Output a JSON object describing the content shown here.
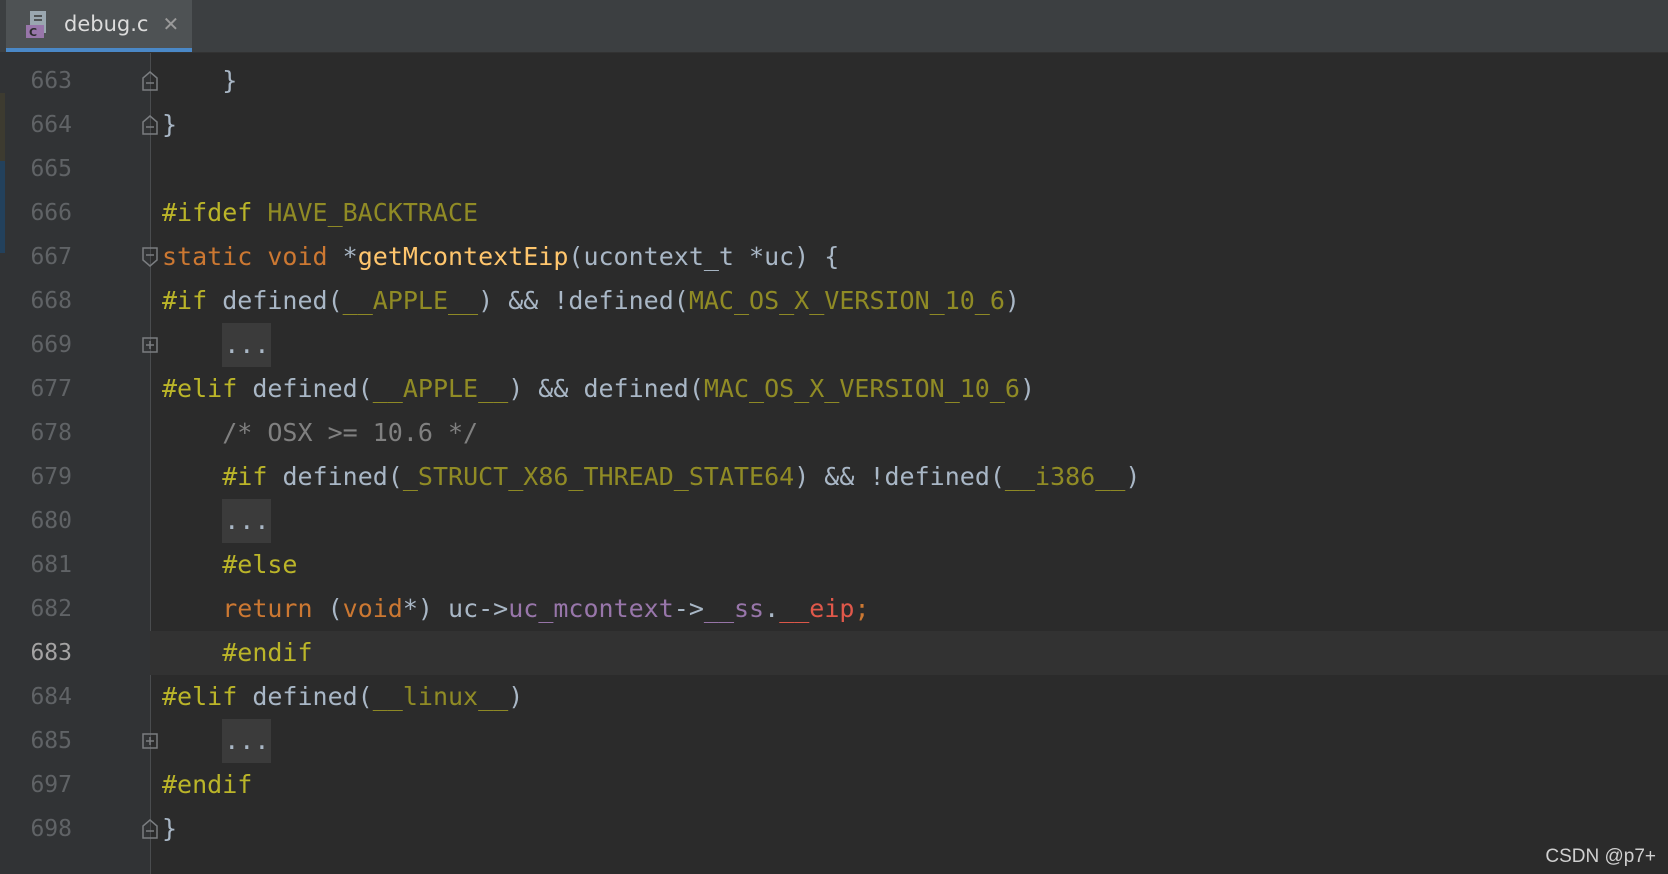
{
  "tab": {
    "filename": "debug.c",
    "icon_letter": "C",
    "close_glyph": "✕"
  },
  "colors": {
    "preprocessor": "#bbb529",
    "macro": "#908b25",
    "keyword": "#cc7832",
    "function": "#ffc66d",
    "field": "#9876aa",
    "comment": "#808080",
    "text": "#a9b7c6",
    "tab_accent": "#4a88c7"
  },
  "lines": [
    {
      "num": "663",
      "fold": "end",
      "tokens": [
        {
          "t": "    }",
          "c": "plain"
        }
      ]
    },
    {
      "num": "664",
      "fold": "end",
      "tokens": [
        {
          "t": "}",
          "c": "plain"
        }
      ]
    },
    {
      "num": "665",
      "fold": "",
      "tokens": []
    },
    {
      "num": "666",
      "fold": "",
      "tokens": [
        {
          "t": "#ifdef ",
          "c": "pre"
        },
        {
          "t": "HAVE_BACKTRACE",
          "c": "macro"
        }
      ]
    },
    {
      "num": "667",
      "fold": "start",
      "tokens": [
        {
          "t": "static ",
          "c": "kw"
        },
        {
          "t": "void ",
          "c": "kw"
        },
        {
          "t": "*",
          "c": "plain"
        },
        {
          "t": "getMcontextEip",
          "c": "fn"
        },
        {
          "t": "(ucontext_t *uc) {",
          "c": "plain"
        }
      ]
    },
    {
      "num": "668",
      "fold": "",
      "tokens": [
        {
          "t": "#if ",
          "c": "pre"
        },
        {
          "t": "defined(",
          "c": "plain"
        },
        {
          "t": "__APPLE__",
          "c": "macro"
        },
        {
          "t": ") && !defined(",
          "c": "plain"
        },
        {
          "t": "MAC_OS_X_VERSION_10_6",
          "c": "macro"
        },
        {
          "t": ")",
          "c": "plain"
        }
      ]
    },
    {
      "num": "669",
      "fold": "collapsed",
      "tokens": [
        {
          "t": "    ",
          "c": "plain"
        },
        {
          "t": "...",
          "c": "folded"
        }
      ]
    },
    {
      "num": "677",
      "fold": "",
      "tokens": [
        {
          "t": "#elif ",
          "c": "pre"
        },
        {
          "t": "defined(",
          "c": "plain"
        },
        {
          "t": "__APPLE__",
          "c": "macro"
        },
        {
          "t": ") && defined(",
          "c": "plain"
        },
        {
          "t": "MAC_OS_X_VERSION_10_6",
          "c": "macro"
        },
        {
          "t": ")",
          "c": "plain"
        }
      ]
    },
    {
      "num": "678",
      "fold": "",
      "tokens": [
        {
          "t": "    /* OSX >= 10.6 */",
          "c": "cmt"
        }
      ]
    },
    {
      "num": "679",
      "fold": "",
      "tokens": [
        {
          "t": "    ",
          "c": "plain"
        },
        {
          "t": "#if ",
          "c": "pre"
        },
        {
          "t": "defined(",
          "c": "plain"
        },
        {
          "t": "_STRUCT_X86_THREAD_STATE64",
          "c": "macro"
        },
        {
          "t": ") && !defined(",
          "c": "plain"
        },
        {
          "t": "__i386__",
          "c": "macro"
        },
        {
          "t": ")",
          "c": "plain"
        }
      ]
    },
    {
      "num": "680",
      "fold": "",
      "tokens": [
        {
          "t": "    ",
          "c": "plain"
        },
        {
          "t": "...",
          "c": "folded"
        }
      ]
    },
    {
      "num": "681",
      "fold": "",
      "tokens": [
        {
          "t": "    ",
          "c": "plain"
        },
        {
          "t": "#else",
          "c": "pre"
        }
      ]
    },
    {
      "num": "682",
      "fold": "",
      "tokens": [
        {
          "t": "    ",
          "c": "plain"
        },
        {
          "t": "return ",
          "c": "kw"
        },
        {
          "t": "(",
          "c": "plain"
        },
        {
          "t": "void",
          "c": "kw"
        },
        {
          "t": "*) uc->",
          "c": "plain"
        },
        {
          "t": "uc_mcontext",
          "c": "field"
        },
        {
          "t": "->",
          "c": "plain"
        },
        {
          "t": "__ss",
          "c": "field"
        },
        {
          "t": ".",
          "c": "plain"
        },
        {
          "t": "__eip",
          "c": "red"
        },
        {
          "t": ";",
          "c": "kw"
        }
      ]
    },
    {
      "num": "683",
      "fold": "",
      "current": true,
      "tokens": [
        {
          "t": "    ",
          "c": "plain"
        },
        {
          "t": "#endif",
          "c": "pre"
        }
      ]
    },
    {
      "num": "684",
      "fold": "",
      "tokens": [
        {
          "t": "#elif ",
          "c": "pre"
        },
        {
          "t": "defined(",
          "c": "plain"
        },
        {
          "t": "__linux__",
          "c": "macro"
        },
        {
          "t": ")",
          "c": "plain"
        }
      ]
    },
    {
      "num": "685",
      "fold": "collapsed",
      "tokens": [
        {
          "t": "    ",
          "c": "plain"
        },
        {
          "t": "...",
          "c": "folded"
        }
      ]
    },
    {
      "num": "697",
      "fold": "",
      "tokens": [
        {
          "t": "#endif",
          "c": "pre"
        }
      ]
    },
    {
      "num": "698",
      "fold": "end",
      "tokens": [
        {
          "t": "}",
          "c": "plain"
        }
      ]
    }
  ],
  "watermark": "CSDN @p7+"
}
